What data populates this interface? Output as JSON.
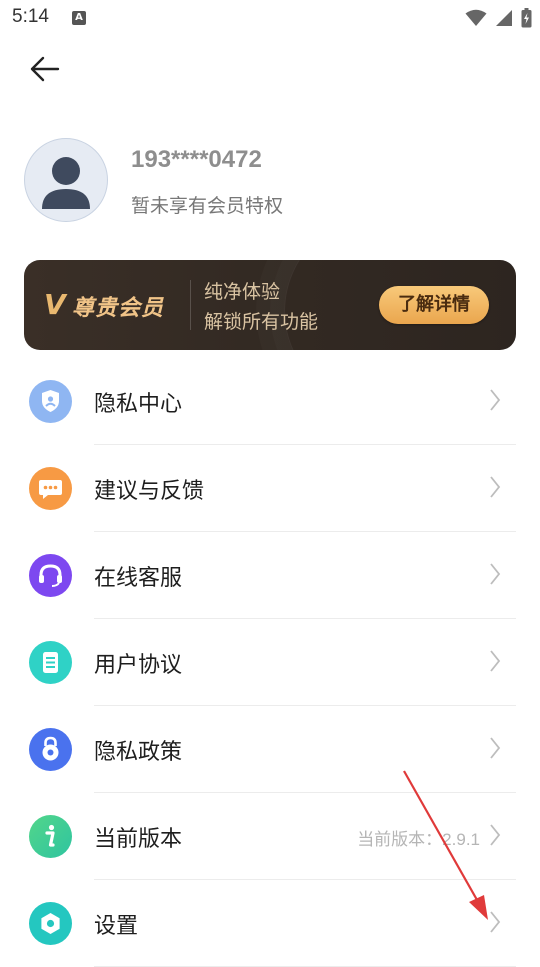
{
  "status_bar": {
    "time": "5:14",
    "notification_badge": "A"
  },
  "profile": {
    "phone": "193****0472",
    "member_status": "暂未享有会员特权"
  },
  "vip_banner": {
    "logo_letter": "V",
    "title": "尊贵会员",
    "line1": "纯净体验",
    "line2": "解锁所有功能",
    "button": "了解详情"
  },
  "menu": {
    "items": [
      {
        "label": "隐私中心",
        "icon": "privacy-shield-icon",
        "color": "#8fb6f2"
      },
      {
        "label": "建议与反馈",
        "icon": "feedback-chat-icon",
        "color": "#f79a44"
      },
      {
        "label": "在线客服",
        "icon": "headset-icon",
        "color": "#7d48f0"
      },
      {
        "label": "用户协议",
        "icon": "document-icon",
        "color": "#2fd2c6"
      },
      {
        "label": "隐私政策",
        "icon": "lock-icon",
        "color": "#4a72ee"
      },
      {
        "label": "当前版本",
        "icon": "info-icon",
        "color": "#3bcf72",
        "value": "当前版本：2.9.1"
      },
      {
        "label": "设置",
        "icon": "gear-icon",
        "color": "#24c7c0"
      }
    ]
  },
  "colors": {
    "accent_gold": "#f1c488",
    "annotation_arrow": "#e03a3a"
  }
}
